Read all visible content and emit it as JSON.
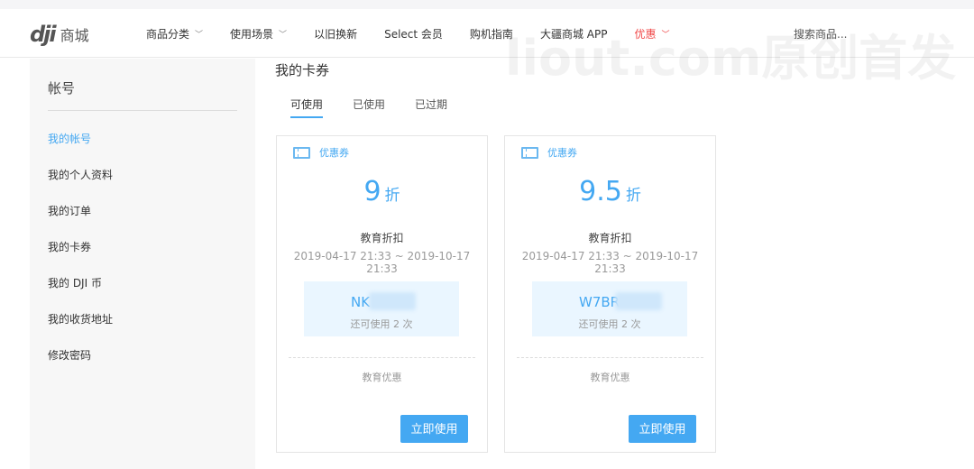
{
  "header": {
    "logo_mark": "dji",
    "logo_text": "商城",
    "nav": [
      {
        "label": "商品分类",
        "chevron": true
      },
      {
        "label": "使用场景",
        "chevron": true
      },
      {
        "label": "以旧换新"
      },
      {
        "label": "Select 会员"
      },
      {
        "label": "购机指南"
      },
      {
        "label": "大疆商城 APP"
      },
      {
        "label": "优惠",
        "chevron": true,
        "highlight": "#f04848"
      }
    ],
    "search_placeholder": "搜索商品..."
  },
  "watermark": "liout.com原创首发",
  "sidebar": {
    "title": "帐号",
    "items": [
      "我的帐号",
      "我的个人资料",
      "我的订单",
      "我的卡券",
      "我的 DJI 币",
      "我的收货地址",
      "修改密码"
    ],
    "active_index": 0
  },
  "main": {
    "title": "我的卡券",
    "tabs": [
      "可使用",
      "已使用",
      "已过期"
    ],
    "active_tab": 0
  },
  "coupons": [
    {
      "type": "优惠券",
      "value": "9",
      "unit": "折",
      "name": "教育折扣",
      "validity": "2019-04-17 21:33 ~ 2019-10-17 21:33",
      "code": "NK",
      "remaining": "还可使用 2 次",
      "desc": "教育优惠",
      "button": "立即使用"
    },
    {
      "type": "优惠券",
      "value": "9.5",
      "unit": "折",
      "name": "教育折扣",
      "validity": "2019-04-17 21:33 ~ 2019-10-17 21:33",
      "code": "W7BR",
      "remaining": "还可使用 2 次",
      "desc": "教育优惠",
      "button": "立即使用"
    }
  ],
  "colors": {
    "accent": "#44a8f2",
    "promo": "#f04848"
  }
}
